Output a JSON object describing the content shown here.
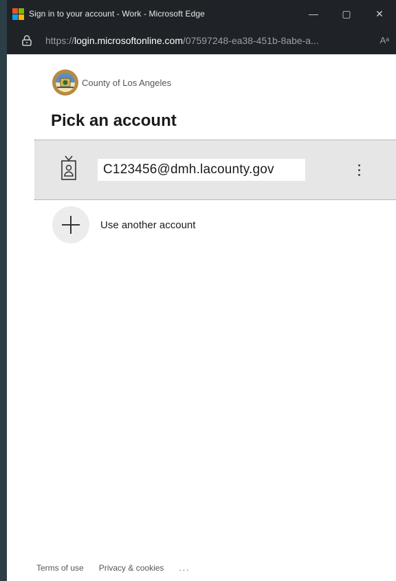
{
  "window": {
    "title": "Sign in to your account - Work - Microsoft Edge",
    "minimize_glyph": "—",
    "maximize_glyph": "▢",
    "close_glyph": "✕"
  },
  "address": {
    "scheme": "https://",
    "host": "login.microsoftonline.com",
    "path": "/07597248-ea38-451b-8abe-a...",
    "read_aloud": "Aᵃ"
  },
  "org": {
    "name": "County of Los Angeles",
    "seal_icon": "county-seal"
  },
  "heading": "Pick an account",
  "accounts": [
    {
      "email": "C123456@dmh.lacounty.gov",
      "icon": "badge-icon"
    }
  ],
  "another_account": {
    "label": "Use another account",
    "icon": "plus-icon"
  },
  "footer": {
    "terms": "Terms of use",
    "privacy": "Privacy & cookies",
    "more": "..."
  },
  "colors": {
    "titlebar": "#1f2327",
    "selected_row": "#e6e6e6",
    "text": "#1b1b1b"
  }
}
